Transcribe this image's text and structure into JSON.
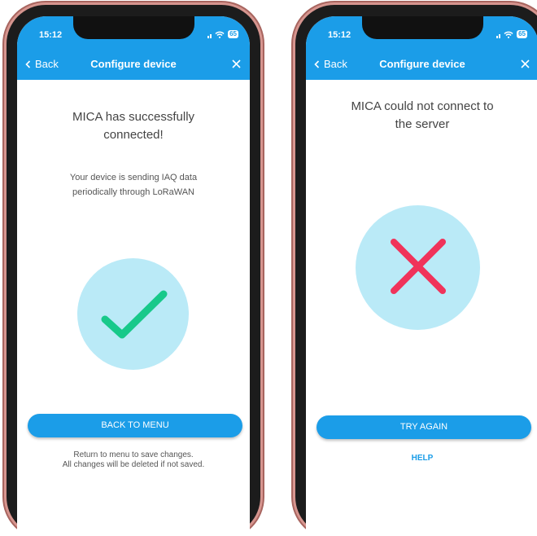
{
  "status_bar": {
    "time": "15:12",
    "battery": "65"
  },
  "nav": {
    "back_label": "Back",
    "title": "Configure device"
  },
  "success_screen": {
    "heading_line1": "MICA has successfully",
    "heading_line2": "connected!",
    "body_line1": "Your device is sending IAQ data",
    "body_line2": "periodically through LoRaWAN",
    "button_label": "BACK TO MENU",
    "footnote_line1": "Return to menu to save changes.",
    "footnote_line2": "All changes will be deleted if not saved.",
    "icon": "checkmark-icon",
    "icon_color": "#18c98a"
  },
  "error_screen": {
    "heading_line1": "MICA could not connect to",
    "heading_line2": "the server",
    "button_label": "TRY AGAIN",
    "help_label": "HELP",
    "icon": "x-mark-icon",
    "icon_color": "#f0335a"
  },
  "colors": {
    "primary": "#1b9de8",
    "circle_bg": "#baeaf7",
    "phone_frame": "#d6958f"
  }
}
